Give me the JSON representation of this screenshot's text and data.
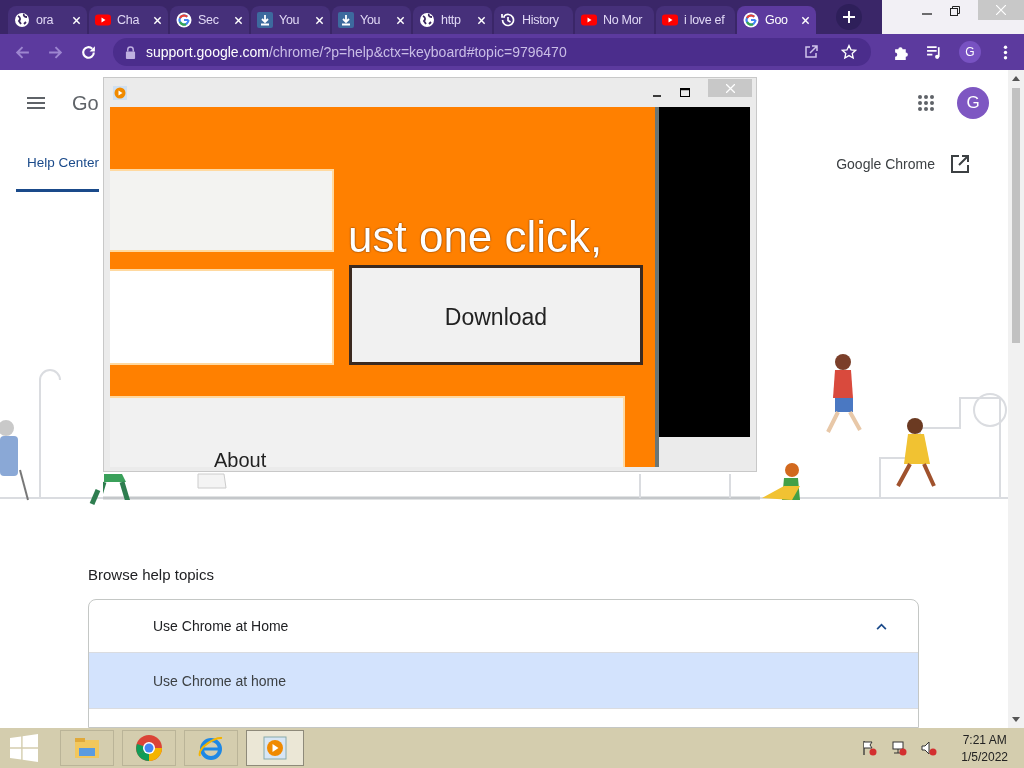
{
  "tabs": [
    {
      "title": "ora",
      "kind": "globe",
      "closable": true,
      "selected": false
    },
    {
      "title": "Cha",
      "kind": "youtube",
      "closable": true,
      "selected": false
    },
    {
      "title": "Sec",
      "kind": "google",
      "closable": true,
      "selected": false
    },
    {
      "title": "You",
      "kind": "download",
      "closable": true,
      "selected": false
    },
    {
      "title": "You",
      "kind": "download",
      "closable": true,
      "selected": false
    },
    {
      "title": "http",
      "kind": "globe",
      "closable": true,
      "selected": false
    },
    {
      "title": "History",
      "kind": "history",
      "closable": false,
      "selected": false
    },
    {
      "title": "No Mor",
      "kind": "youtube",
      "closable": false,
      "selected": false
    },
    {
      "title": "i love ef",
      "kind": "youtube",
      "closable": false,
      "selected": false
    },
    {
      "title": "Goo",
      "kind": "google",
      "closable": true,
      "selected": true
    }
  ],
  "address_bar": {
    "host": "support.google.com",
    "path": "/chrome/?p=help&ctx=keyboard#topic=9796470"
  },
  "profile": {
    "initial": "G"
  },
  "page": {
    "logo_text": "Go",
    "avatar_initial": "G",
    "nav_tab": {
      "label": "Help Center",
      "selected": true
    },
    "product_link": "Google Chrome",
    "section_title": "Browse help topics",
    "topics": [
      {
        "title": "Use Chrome at Home",
        "expanded": true,
        "children": [
          {
            "label": "Use Chrome at home",
            "selected": true
          }
        ]
      }
    ]
  },
  "app_window": {
    "headline": "ust one click,",
    "button": "Download",
    "label": "About"
  },
  "taskbar": {
    "apps": [
      {
        "kind": "explorer",
        "active": false
      },
      {
        "kind": "chrome",
        "active": false
      },
      {
        "kind": "ie",
        "active": false
      },
      {
        "kind": "player",
        "active": true
      }
    ],
    "time": "7:21 AM",
    "date": "1/5/2022"
  }
}
